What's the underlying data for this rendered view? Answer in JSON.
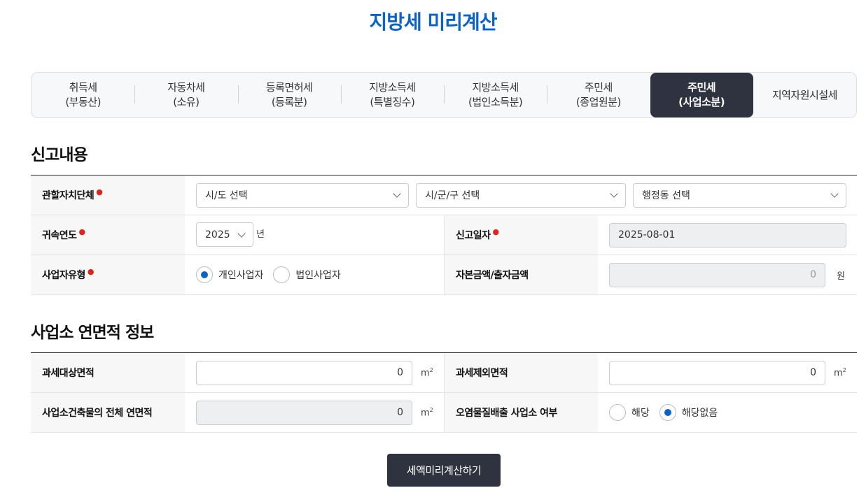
{
  "page": {
    "title": "지방세 미리계산"
  },
  "tabs": [
    {
      "line1": "취득세",
      "line2": "(부동산)"
    },
    {
      "line1": "자동차세",
      "line2": "(소유)"
    },
    {
      "line1": "등록면허세",
      "line2": "(등록분)"
    },
    {
      "line1": "지방소득세",
      "line2": "(특별징수)"
    },
    {
      "line1": "지방소득세",
      "line2": "(법인소득분)"
    },
    {
      "line1": "주민세",
      "line2": "(종업원분)"
    },
    {
      "line1": "주민세",
      "line2": "(사업소분)"
    },
    {
      "line1": "지역자원시설세",
      "line2": ""
    }
  ],
  "active_tab_index": 6,
  "report": {
    "title": "신고내용",
    "jurisdiction_label": "관할자치단체",
    "sido_select": "시/도 선택",
    "sigungu_select": "시/군/구 선택",
    "dong_select": "행정동 선택",
    "year_label": "귀속연도",
    "year_value": "2025",
    "year_unit": "년",
    "report_date_label": "신고일자",
    "report_date_value": "2025-08-01",
    "business_type_label": "사업자유형",
    "business_type_options": [
      "개인사업자",
      "법인사업자"
    ],
    "business_type_selected": "개인사업자",
    "capital_label": "자본금액/출자금액",
    "capital_value": "0",
    "capital_unit": "원",
    "required_mark": "●"
  },
  "area": {
    "title": "사업소 연면적 정보",
    "taxable_label": "과세대상면적",
    "taxable_value": "0",
    "excluded_label": "과세제외면적",
    "excluded_value": "0",
    "total_label": "사업소건축물의 전체 연면적",
    "total_value": "0",
    "unit_m": "m",
    "unit_sup": "2",
    "pollution_label": "오염물질배출 사업소 여부",
    "pollution_options": [
      "해당",
      "해당없음"
    ],
    "pollution_selected": "해당없음"
  },
  "submit_label": "세액미리계산하기",
  "colors": {
    "primary": "#0b63c7",
    "dark": "#2f3340",
    "required": "#e0241b"
  }
}
